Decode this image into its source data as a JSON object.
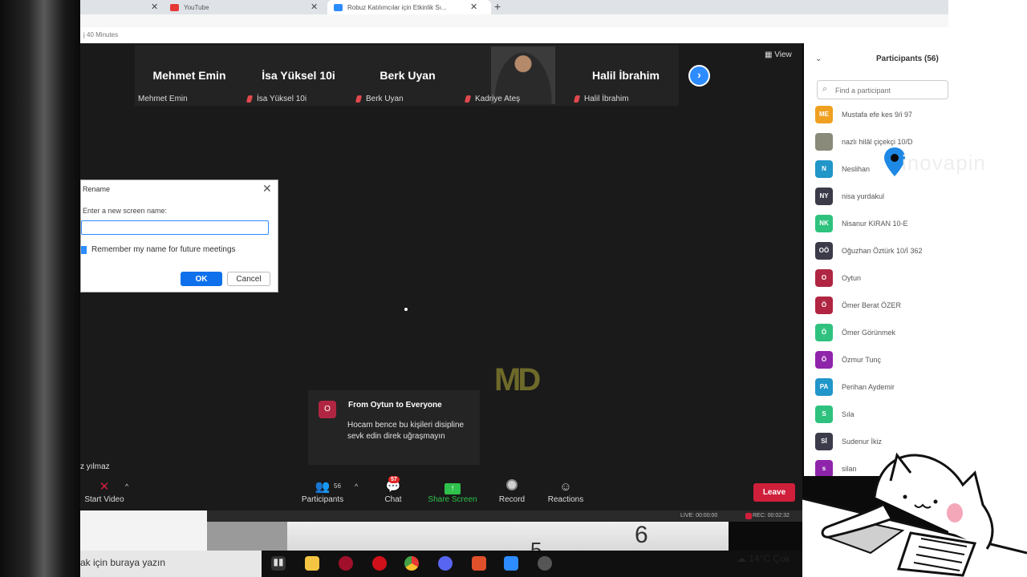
{
  "browser": {
    "tabs": [
      {
        "label": "",
        "icon": "blank-tab-icon"
      },
      {
        "label": "YouTube",
        "icon": "youtube-icon"
      },
      {
        "label": "Robuz Katılımcılar için Etkinlik Sı...",
        "icon": "zoom-icon"
      }
    ],
    "new_tab": "+"
  },
  "window": {
    "title": "j 40 Minutes"
  },
  "meeting": {
    "view_label": "View",
    "tiles": [
      {
        "display": "Mehmet Emin",
        "label": "Mehmet Emin",
        "muted": false
      },
      {
        "display": "İsa Yüksel 10i",
        "label": "İsa Yüksel 10i",
        "muted": true
      },
      {
        "display": "Berk Uyan",
        "label": "Berk Uyan",
        "muted": true
      },
      {
        "display": "",
        "label": "Kadriye Ateş",
        "muted": true,
        "has_video": true
      },
      {
        "display": "Halil İbrahim",
        "label": "Halil İbrahim",
        "muted": true
      }
    ],
    "self_name_tag": "z yılmaz",
    "watermark": "MD"
  },
  "rename_dialog": {
    "title": "Rename",
    "prompt": "Enter a new screen name:",
    "input_value": "",
    "remember_label": "Remember my name for future meetings",
    "remember_checked": true,
    "ok_label": "OK",
    "cancel_label": "Cancel"
  },
  "chat_toast": {
    "avatar": "O",
    "from": "From Oytun to Everyone",
    "message": "Hocam bence bu kişileri disipline sevk edin direk uğraşmayın"
  },
  "toolbar": {
    "start_video": "Start Video",
    "participants": "Participants",
    "participants_count": "56",
    "chat": "Chat",
    "chat_badge": "57",
    "share_screen": "Share Screen",
    "record": "Record",
    "reactions": "Reactions",
    "leave": "Leave"
  },
  "statusbar": {
    "live": "LIVE: 00:00:00",
    "rec": "REC: 00:02:32"
  },
  "participants_panel": {
    "title": "Participants (56)",
    "search_placeholder": "Find a participant",
    "list": [
      {
        "initials": "ME",
        "name": "Mustafa efe kes 9/i 97",
        "color": "#f0a020"
      },
      {
        "initials": "",
        "name": "nazlı hilâl çiçekçi 10/D",
        "color": "#8a8a7a"
      },
      {
        "initials": "N",
        "name": "Neslihan",
        "color": "#2196c9"
      },
      {
        "initials": "NY",
        "name": "nisa yurdakul",
        "color": "#3b3b4a"
      },
      {
        "initials": "NK",
        "name": "Nisanur KIRAN 10-E",
        "color": "#2ec27e"
      },
      {
        "initials": "OÖ",
        "name": "Oğuzhan Öztürk 10/İ 362",
        "color": "#3b3b4a"
      },
      {
        "initials": "O",
        "name": "Oytun",
        "color": "#b02642"
      },
      {
        "initials": "Ö",
        "name": "Ömer Berat ÖZER",
        "color": "#b02642"
      },
      {
        "initials": "Ö",
        "name": "Ömer Görünmek",
        "color": "#2ec27e"
      },
      {
        "initials": "Ö",
        "name": "Özmur Tunç",
        "color": "#8e24aa"
      },
      {
        "initials": "PA",
        "name": "Perihan Aydemir",
        "color": "#2196c9"
      },
      {
        "initials": "S",
        "name": "Sıla",
        "color": "#2ec27e"
      },
      {
        "initials": "Sİ",
        "name": "Sudenur İkiz",
        "color": "#3b3b4a"
      },
      {
        "initials": "s",
        "name": "silan",
        "color": "#8e24aa"
      }
    ]
  },
  "overlay_watermark": "inovapin",
  "desktop": {
    "digit_a": "6",
    "digit_b": "5"
  },
  "taskbar": {
    "search_text": "ak için buraya yazın",
    "weather": "14°C Çok"
  }
}
